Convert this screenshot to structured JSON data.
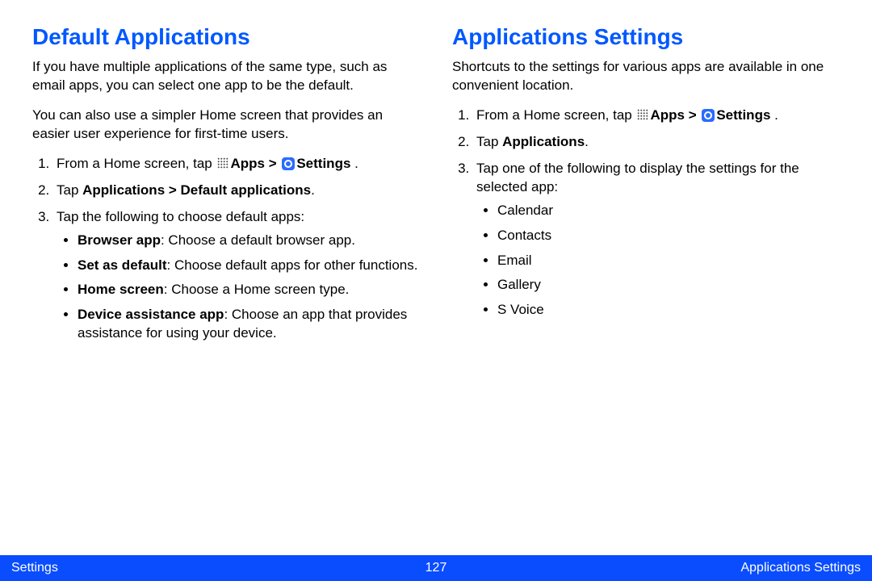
{
  "left": {
    "heading": "Default Applications",
    "para1": "If you have multiple applications of the same type, such as email apps, you can select one app to be the default.",
    "para2": "You can also use a simpler Home screen that provides an easier user experience for first-time users.",
    "step1_a": "From a Home screen, tap ",
    "step1_apps": "Apps > ",
    "step1_settings": "Settings",
    "step1_end": " .",
    "step2_a": "Tap ",
    "step2_b": "Applications > Default applications",
    "step2_c": ".",
    "step3": "Tap the following to choose default apps:",
    "bullets": [
      {
        "label": "Browser app",
        "desc": ": Choose a default browser app."
      },
      {
        "label": "Set as default",
        "desc": ": Choose default apps for other functions."
      },
      {
        "label": "Home screen",
        "desc": ": Choose a Home screen type."
      },
      {
        "label": "Device assistance app",
        "desc": ": Choose an app that provides assistance for using your device."
      }
    ]
  },
  "right": {
    "heading": "Applications Settings",
    "para1": "Shortcuts to the settings for various apps are available in one convenient location.",
    "step1_a": "From a Home screen, tap ",
    "step1_apps": "Apps > ",
    "step1_settings": "Settings",
    "step1_end": " .",
    "step2_a": "Tap ",
    "step2_b": "Applications",
    "step2_c": ".",
    "step3": "Tap one of the following to display the settings for the selected app:",
    "apps": [
      "Calendar",
      "Contacts",
      "Email",
      "Gallery",
      "S Voice"
    ]
  },
  "footer": {
    "left": "Settings",
    "page": "127",
    "right": "Applications Settings"
  }
}
